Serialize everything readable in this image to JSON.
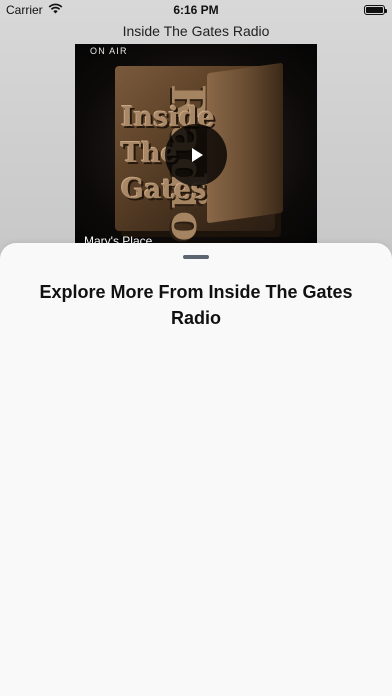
{
  "status_bar": {
    "carrier": "Carrier",
    "time": "6:16 PM",
    "wifi_icon": "wifi-icon",
    "battery_icon": "battery-icon",
    "battery_level": 1.0
  },
  "nav": {
    "title": "Inside The Gates Radio"
  },
  "player": {
    "badge": "ON AIR",
    "artwork_logo_lines": [
      "Inside",
      "The",
      "Gates"
    ],
    "artwork_logo_side": "Radio",
    "play_icon": "play-icon",
    "now_playing_title": "Mary's Place"
  },
  "sheet": {
    "grabber_icon": "grabber-handle",
    "title": "Explore More From Inside The Gates Radio"
  },
  "colors": {
    "sheet_background": "#f9f9f9",
    "grabber": "#5c6670",
    "play_button": "#000000"
  }
}
